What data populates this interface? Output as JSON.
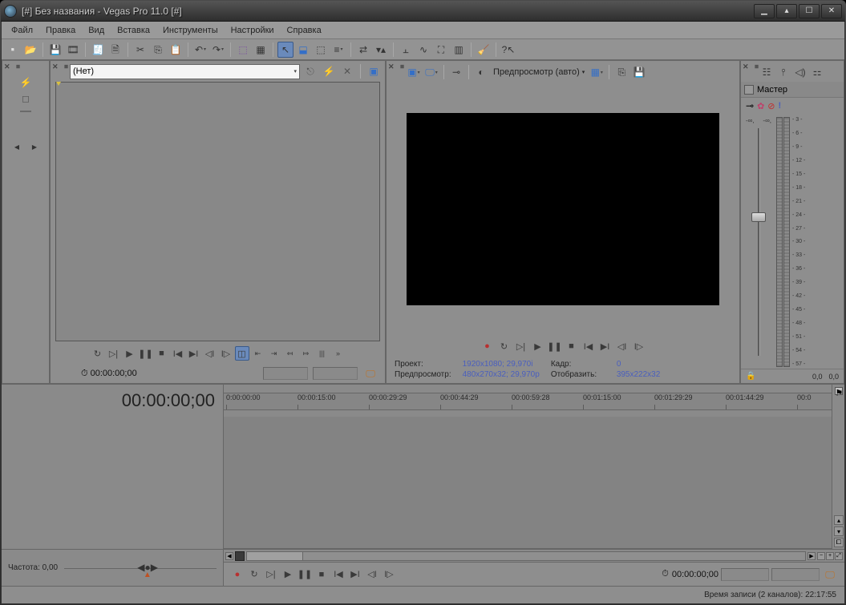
{
  "title": "[#] Без названия - Vegas Pro 11.0  [#]",
  "menu": [
    "Файл",
    "Правка",
    "Вид",
    "Вставка",
    "Инструменты",
    "Настройки",
    "Справка"
  ],
  "trimmer": {
    "select_value": "(Нет)",
    "timecode": "00:00:00;00"
  },
  "preview": {
    "quality_label": "Предпросмотр (авто)",
    "info": {
      "project_label": "Проект:",
      "project_value": "1920x1080; 29,970i",
      "frame_label": "Кадр:",
      "frame_value": "0",
      "preview_label": "Предпросмотр:",
      "preview_value": "480x270x32; 29,970p",
      "display_label": "Отобразить:",
      "display_value": "395x222x32"
    }
  },
  "master": {
    "title": "Мастер",
    "scale": [
      "3",
      "6",
      "9",
      "12",
      "15",
      "18",
      "21",
      "24",
      "27",
      "30",
      "33",
      "36",
      "39",
      "42",
      "45",
      "48",
      "51",
      "54",
      "57"
    ],
    "bottom_l": "0,0",
    "bottom_r": "0,0",
    "inf": "-∞,"
  },
  "timeline": {
    "big_timecode": "00:00:00;00",
    "ruler": [
      "0:00:00:00",
      "00:00:15:00",
      "00:00:29:29",
      "00:00:44:29",
      "00:00:59:28",
      "00:01:15:00",
      "00:01:29:29",
      "00:01:44:29",
      "00:0"
    ],
    "rate_label": "Частота: 0,00",
    "footer_timecode": "00:00:00;00"
  },
  "status": "Время записи (2 каналов):  22:17:55"
}
